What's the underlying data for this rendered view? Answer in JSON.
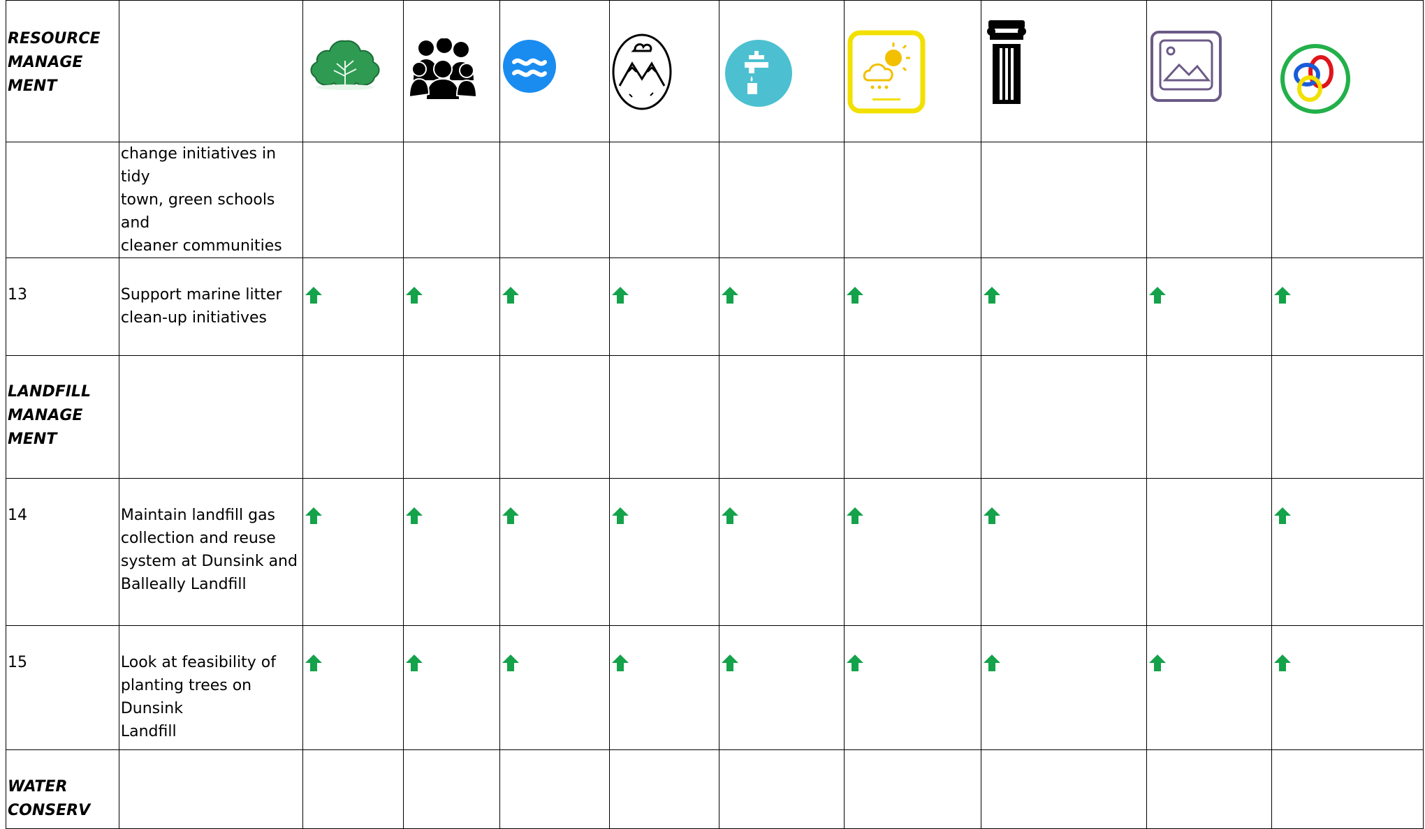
{
  "columns_icons": [
    "tree-icon",
    "people-icon",
    "water-waves-icon",
    "mountain-landscape-icon",
    "water-tap-icon",
    "climate-weather-icon",
    "heritage-pillar-icon",
    "landscape-picture-icon",
    "interrelationships-rings-icon"
  ],
  "colors": {
    "arrow_green": "#14a24a",
    "tree_green": "#2e9a52",
    "waves_blue": "#1a8cf0",
    "tap_teal": "#4cc0d0",
    "climate_yellow": "#f2e000",
    "picture_purple": "#6b5a86"
  },
  "rows": [
    {
      "kind": "section",
      "label_lines": [
        "RESOURCE",
        "MANAGE",
        "MENT"
      ],
      "number": "",
      "description_lines": [],
      "arrows": [
        false,
        false,
        false,
        false,
        false,
        false,
        false,
        false,
        false
      ]
    },
    {
      "kind": "item",
      "label_lines": [],
      "number": "",
      "description_lines": [
        "change initiatives in tidy",
        "town, green schools and",
        "cleaner communities"
      ],
      "arrows": [
        false,
        false,
        false,
        false,
        false,
        false,
        false,
        false,
        false
      ]
    },
    {
      "kind": "item",
      "label_lines": [],
      "number": "13",
      "description_lines": [
        "Support marine litter",
        "clean-up initiatives"
      ],
      "arrows": [
        true,
        true,
        true,
        true,
        true,
        true,
        true,
        true,
        true
      ]
    },
    {
      "kind": "section",
      "label_lines": [
        "LANDFILL",
        "MANAGE",
        "MENT"
      ],
      "number": "",
      "description_lines": [],
      "arrows": [
        false,
        false,
        false,
        false,
        false,
        false,
        false,
        false,
        false
      ]
    },
    {
      "kind": "item",
      "label_lines": [],
      "number": "14",
      "description_lines": [
        "Maintain landfill gas",
        "collection and reuse",
        "system at Dunsink and",
        "Balleally Landfill"
      ],
      "arrows": [
        true,
        true,
        true,
        true,
        true,
        true,
        true,
        false,
        true
      ]
    },
    {
      "kind": "item",
      "label_lines": [],
      "number": "15",
      "description_lines": [
        "Look at feasibility of",
        "planting trees on Dunsink",
        "Landfill"
      ],
      "arrows": [
        true,
        true,
        true,
        true,
        true,
        true,
        true,
        true,
        true
      ]
    },
    {
      "kind": "section",
      "label_lines": [
        "WATER",
        "CONSERV"
      ],
      "number": "",
      "description_lines": [],
      "arrows": [
        false,
        false,
        false,
        false,
        false,
        false,
        false,
        false,
        false
      ]
    }
  ]
}
